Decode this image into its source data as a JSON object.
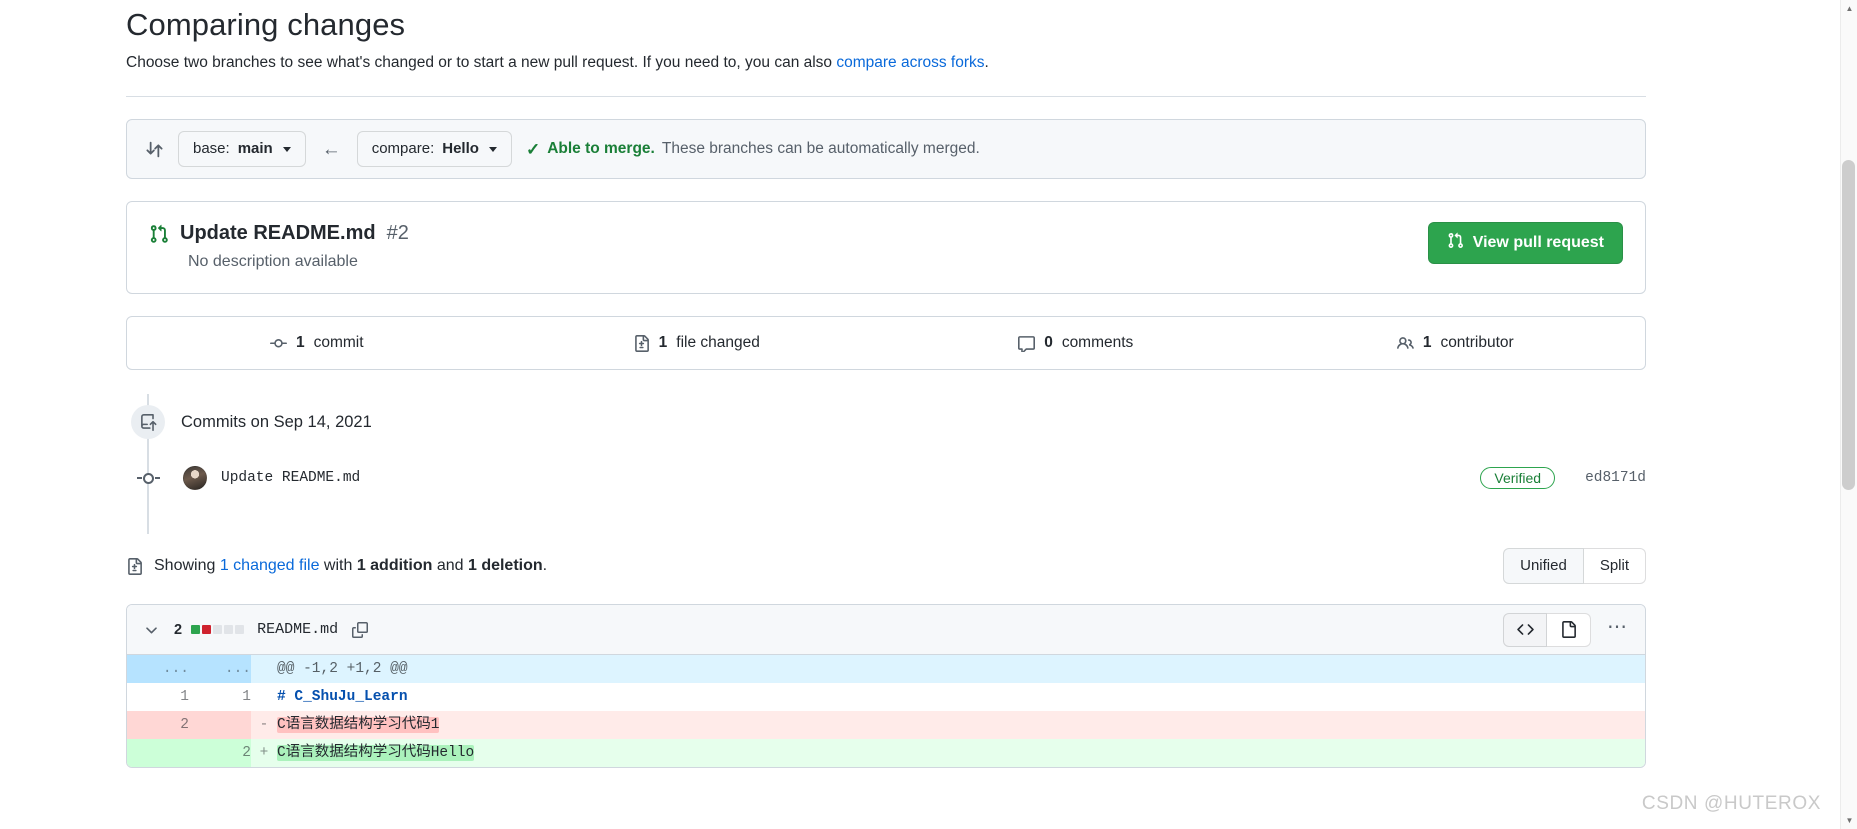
{
  "header": {
    "title": "Comparing changes",
    "subtitle_before": "Choose two branches to see what's changed or to start a new pull request. If you need to, you can also ",
    "subtitle_link": "compare across forks",
    "subtitle_after": "."
  },
  "branch_bar": {
    "compare_icon": "git-compare-icon",
    "base_lead": "base:",
    "base_value": "main",
    "arrow": "←",
    "compare_lead": "compare:",
    "compare_value": "Hello",
    "check_icon": "check-icon",
    "merge_strong": "Able to merge.",
    "merge_rest": " These branches can be automatically merged."
  },
  "pull_request": {
    "icon": "git-pull-request-icon",
    "title": "Update README.md",
    "number": "#2",
    "description": "No description available",
    "button_icon": "git-pull-request-icon",
    "button_label": "View pull request"
  },
  "stats": [
    {
      "icon": "commit-icon",
      "count": "1",
      "label": "commit"
    },
    {
      "icon": "file-diff-icon",
      "count": "1",
      "label": "file changed"
    },
    {
      "icon": "comment-icon",
      "count": "0",
      "label": "comments"
    },
    {
      "icon": "people-icon",
      "count": "1",
      "label": "contributor"
    }
  ],
  "commits": {
    "header_icon": "repo-push-icon",
    "header_label": "Commits on Sep 14, 2021",
    "items": [
      {
        "avatar": "user-avatar",
        "message": "Update README.md",
        "verified_badge": "Verified",
        "sha": "ed8171d"
      }
    ]
  },
  "showing": {
    "icon": "file-diff-icon",
    "prefix": "Showing ",
    "changed_file": "1 changed file",
    "middle": " with ",
    "additions": "1 addition",
    "conjunction": " and ",
    "deletions": "1 deletion",
    "suffix": ".",
    "view_modes": [
      {
        "label": "Unified",
        "active": true
      },
      {
        "label": "Split",
        "active": false
      }
    ]
  },
  "file_diff": {
    "chevron_icon": "chevron-down-icon",
    "changes_count": "2",
    "stat_blocks": [
      "add",
      "del",
      "neu",
      "neu",
      "neu"
    ],
    "filename": "README.md",
    "copy_icon": "copy-icon",
    "actions": [
      {
        "icon": "code-icon",
        "active": true
      },
      {
        "icon": "file-icon",
        "active": false
      }
    ],
    "kebab_icon": "kebab-horizontal-icon",
    "rows": [
      {
        "type": "hunk",
        "left": "...",
        "right": "...",
        "marker": "",
        "code": "@@ -1,2 +1,2 @@"
      },
      {
        "type": "ctx",
        "left": "1",
        "right": "1",
        "marker": "",
        "code": "# C_ShuJu_Learn"
      },
      {
        "type": "del",
        "left": "2",
        "right": "",
        "marker": "-",
        "code": "C语言数据结构学习代码1"
      },
      {
        "type": "add",
        "left": "",
        "right": "2",
        "marker": "+",
        "code": "C语言数据结构学习代码Hello"
      }
    ]
  },
  "watermark": "CSDN @HUTEROX",
  "colors": {
    "accent_link": "#0969da",
    "success_green": "#1a7f37",
    "button_green": "#2da44e",
    "addition_bg": "#e6ffec",
    "deletion_bg": "#ffebe9",
    "hunk_bg": "#ddf4ff",
    "border": "#d0d7de"
  }
}
